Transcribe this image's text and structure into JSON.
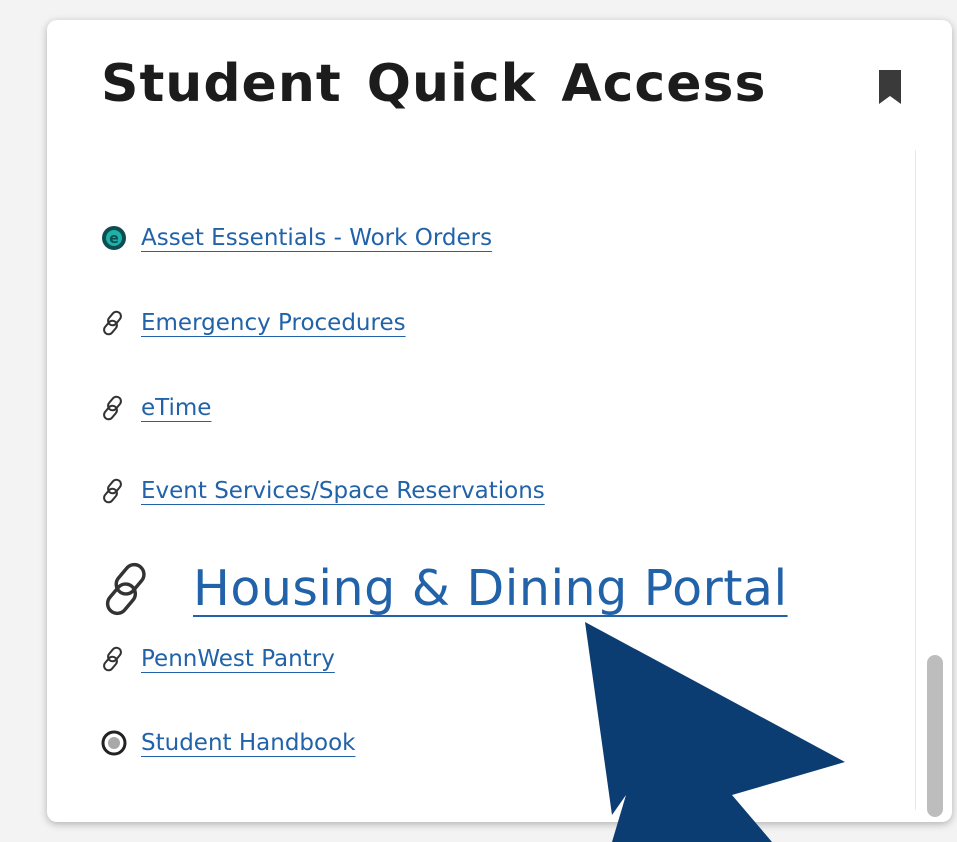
{
  "widget": {
    "title": "Student Quick Access",
    "bookmark_icon": "bookmark-icon",
    "links": [
      {
        "label": "Asset Essentials - Work Orders",
        "icon": "asset-essentials-logo-icon"
      },
      {
        "label": "Emergency Procedures",
        "icon": "link-icon"
      },
      {
        "label": "eTime",
        "icon": "link-icon"
      },
      {
        "label": "Event Services/Space Reservations",
        "icon": "link-icon"
      },
      {
        "label": "Housing & Dining Portal",
        "icon": "link-icon"
      },
      {
        "label": "PennWest Pantry",
        "icon": "link-icon"
      },
      {
        "label": "Student Handbook",
        "icon": "circle-logo-icon"
      }
    ]
  },
  "colors": {
    "link": "#2162a8",
    "title": "#1c1c1c",
    "cursor": "#0b3d72",
    "asset_logo": "#0f4b52"
  }
}
